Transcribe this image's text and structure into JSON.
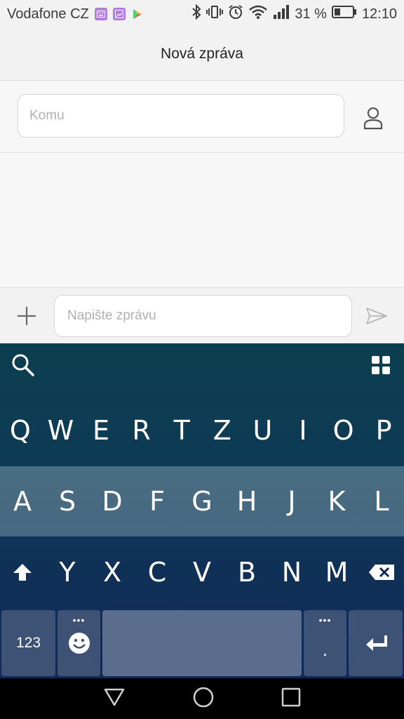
{
  "status_bar": {
    "carrier": "Vodafone CZ",
    "battery_percent": "31 %",
    "time": "12:10"
  },
  "header": {
    "title": "Nová zpráva"
  },
  "recipient": {
    "placeholder": "Komu"
  },
  "compose": {
    "placeholder": "Napište zprávu"
  },
  "keyboard": {
    "row1": [
      "Q",
      "W",
      "E",
      "R",
      "T",
      "Z",
      "U",
      "I",
      "O",
      "P"
    ],
    "row2": [
      "A",
      "S",
      "D",
      "F",
      "G",
      "H",
      "J",
      "K",
      "L"
    ],
    "row3": [
      "Y",
      "X",
      "C",
      "V",
      "B",
      "N",
      "M"
    ],
    "numbers_label": "123",
    "period_label": ".",
    "more_dots": "•••"
  },
  "colors": {
    "keyboard_top": "#0c3e4f",
    "keyboard_bottom": "#10285a",
    "row2_highlight": "#5e8092",
    "function_key": "#3d5274",
    "space_key": "#5a6d8c"
  }
}
